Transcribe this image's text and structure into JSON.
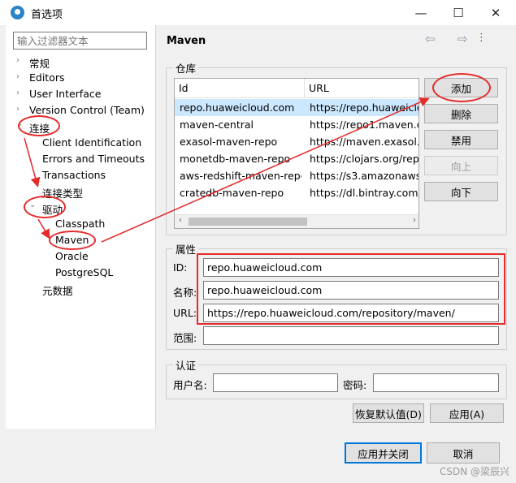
{
  "window": {
    "title": "首选项",
    "minimize_glyph": "—",
    "maximize_glyph": "☐",
    "close_glyph": "✕"
  },
  "filter": {
    "placeholder": "输入过滤器文本"
  },
  "tree": {
    "items": [
      {
        "label": "常规",
        "twisty": "›"
      },
      {
        "label": "Editors",
        "twisty": "›"
      },
      {
        "label": "User Interface",
        "twisty": "›"
      },
      {
        "label": "Version Control (Team)",
        "twisty": "›"
      },
      {
        "label": "连接",
        "twisty": "⌄"
      },
      {
        "label": "Client Identification"
      },
      {
        "label": "Errors and Timeouts"
      },
      {
        "label": "Transactions"
      },
      {
        "label": "连接类型"
      },
      {
        "label": "驱动",
        "twisty": "⌄"
      },
      {
        "label": "Classpath"
      },
      {
        "label": "Maven"
      },
      {
        "label": "Oracle"
      },
      {
        "label": "PostgreSQL"
      },
      {
        "label": "元数据"
      }
    ]
  },
  "page": {
    "title": "Maven",
    "nav_back": "⇦",
    "nav_forward": "⇨",
    "menu": "⋮"
  },
  "repo_group": {
    "legend": "仓库",
    "columns": [
      "Id",
      "URL"
    ],
    "rows": [
      {
        "id": "repo.huaweicloud.com",
        "url": "https://repo.huaweiclo"
      },
      {
        "id": "maven-central",
        "url": "https://repo1.maven.or"
      },
      {
        "id": "exasol-maven-repo",
        "url": "https://maven.exasol.cc"
      },
      {
        "id": "monetdb-maven-repo",
        "url": "https://clojars.org/repc"
      },
      {
        "id": "aws-redshift-maven-repo",
        "url": "https://s3.amazonaws.c"
      },
      {
        "id": "cratedb-maven-repo",
        "url": "https://dl.bintray.com/c"
      }
    ],
    "scroll_left": "‹",
    "scroll_right": "›",
    "buttons": {
      "add": "添加",
      "delete": "删除",
      "disable": "禁用",
      "up": "向上",
      "down": "向下"
    }
  },
  "props_group": {
    "legend": "属性",
    "id_label": "ID:",
    "id_value": "repo.huaweicloud.com",
    "name_label": "名称:",
    "name_value": "repo.huaweicloud.com",
    "url_label": "URL:",
    "url_value": "https://repo.huaweicloud.com/repository/maven/",
    "scope_label": "范围:",
    "scope_value": ""
  },
  "auth_group": {
    "legend": "认证",
    "user_label": "用户名:",
    "user_value": "",
    "password_label": "密码:",
    "password_value": ""
  },
  "page_buttons": {
    "restore_defaults": "恢复默认值(D)",
    "apply": "应用(A)"
  },
  "footer": {
    "apply_close": "应用并关闭",
    "cancel": "取消"
  },
  "watermark": "CSDN @梁辰兴",
  "annotation_color": "#e52a2a"
}
